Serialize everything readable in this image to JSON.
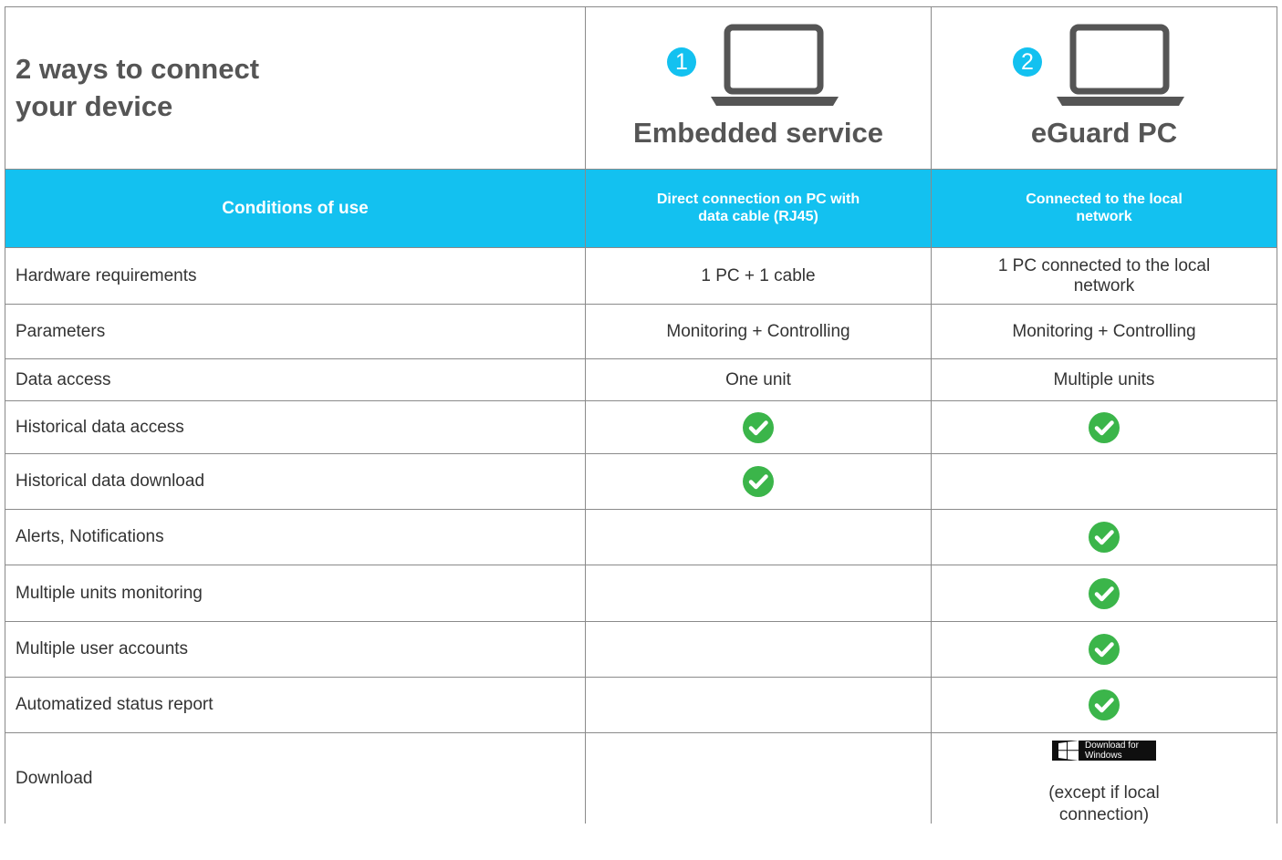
{
  "header": {
    "title_line1": "2 ways to connect",
    "title_line2": "your device",
    "options": [
      {
        "number": "1",
        "name": "Embedded service",
        "icon": "laptop-icon"
      },
      {
        "number": "2",
        "name": "eGuard PC",
        "icon": "laptop-icon"
      }
    ]
  },
  "conditions": {
    "label": "Conditions of use",
    "option1": "Direct connection on PC with data cable (RJ45)",
    "option2": "Connected to the local network"
  },
  "rows": [
    {
      "label": "Hardware requirements",
      "col1": "1 PC + 1 cable",
      "col2": "1 PC connected to the local network"
    },
    {
      "label": "Parameters",
      "col1": "Monitoring + Controlling",
      "col2": "Monitoring + Controlling"
    },
    {
      "label": "Data access",
      "col1": "One unit",
      "col2": "Multiple units"
    },
    {
      "label": "Historical data access",
      "col1_check": true,
      "col2_check": true
    },
    {
      "label": "Historical data download",
      "col1_check": true,
      "col2_check": false
    },
    {
      "label": "Alerts, Notifications",
      "col1_check": false,
      "col2_check": true
    },
    {
      "label": "Multiple units monitoring",
      "col1_check": false,
      "col2_check": true
    },
    {
      "label": "Multiple user accounts",
      "col1_check": false,
      "col2_check": true
    },
    {
      "label": "Automatized status report",
      "col1_check": false,
      "col2_check": true
    },
    {
      "label": "Download",
      "col1": "",
      "col2_badge_line1": "Download for",
      "col2_badge_line2": "Windows",
      "col2_note": "(except if local connection)"
    }
  ],
  "colors": {
    "accent": "#13c1f0",
    "check": "#3bb54a",
    "text": "#333333",
    "heading": "#555555"
  }
}
